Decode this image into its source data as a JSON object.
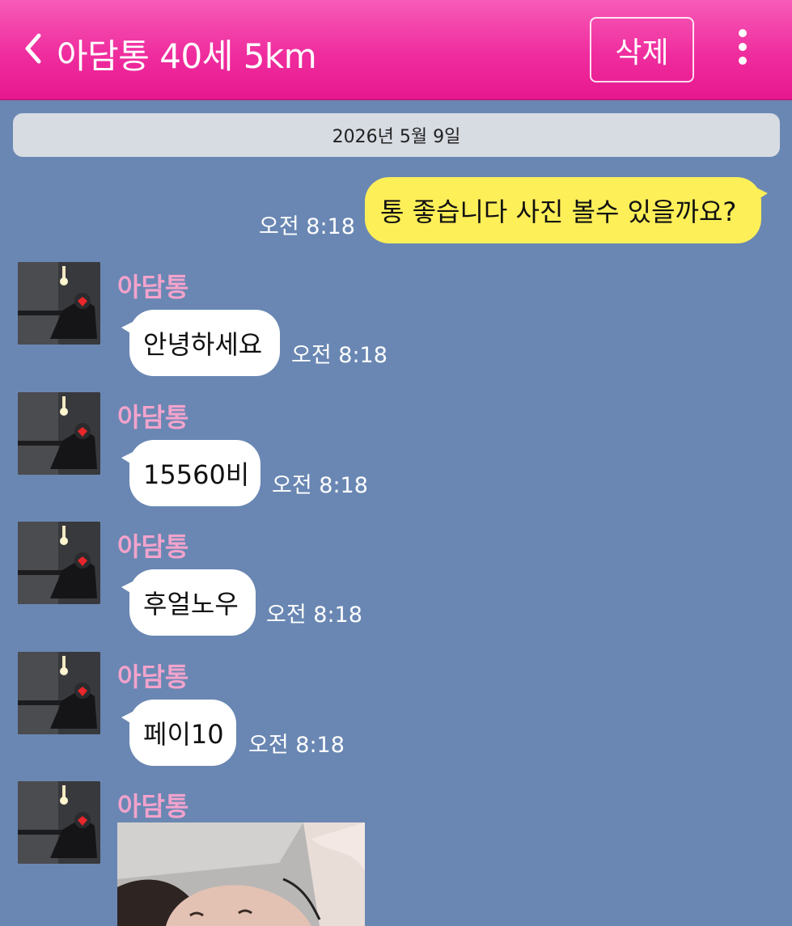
{
  "header": {
    "title": "아담통 40세 5km",
    "delete_label": "삭제",
    "back_icon": "chevron-left-icon",
    "more_icon": "more-vertical-icon",
    "colors": {
      "bar": "#ef2d9e",
      "text": "#ffffff"
    }
  },
  "chat": {
    "date_divider": "2026년 5월 9일",
    "outgoing": {
      "text": "통 좋습니다 사진 볼수 있을까요?",
      "time": "오전 8:18"
    },
    "incoming": [
      {
        "sender": "아담통",
        "text": "안녕하세요",
        "time": "오전 8:18"
      },
      {
        "sender": "아담통",
        "text": "15560비",
        "time": "오전 8:18"
      },
      {
        "sender": "아담통",
        "text": "후얼노우",
        "time": "오전 8:18"
      },
      {
        "sender": "아담통",
        "text": "페이10",
        "time": "오전 8:18"
      },
      {
        "sender": "아담통"
      }
    ],
    "colors": {
      "background": "#6a87b3",
      "outgoing_bubble": "#fdef58",
      "incoming_bubble": "#ffffff",
      "sender_name": "#f3a3cc"
    }
  }
}
